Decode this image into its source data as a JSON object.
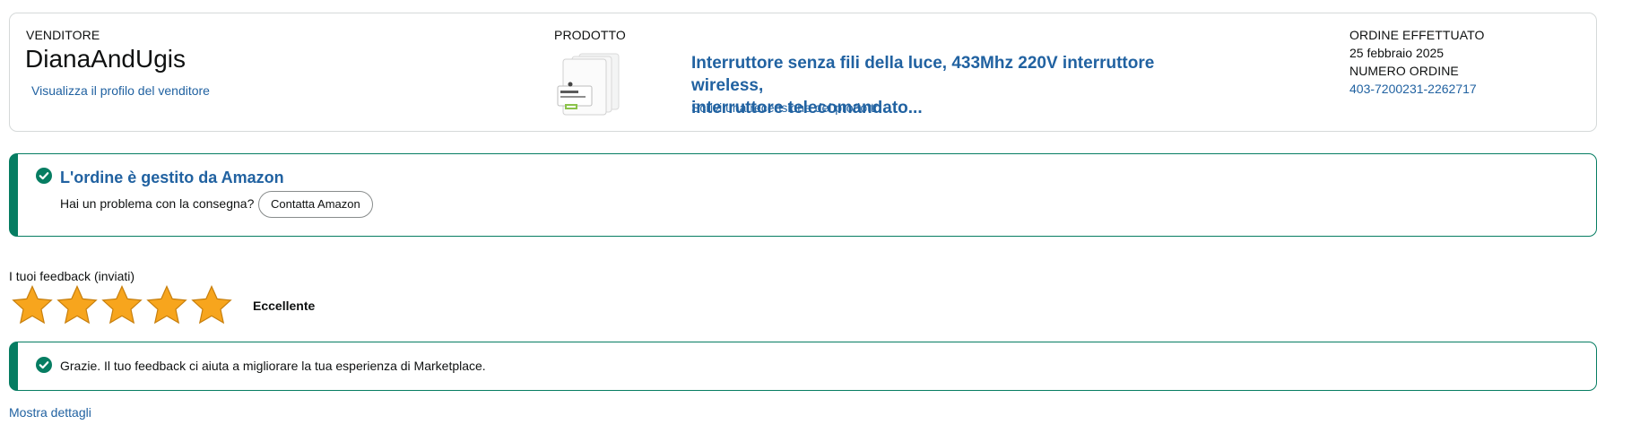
{
  "seller": {
    "caption": "VENDITORE",
    "name": "DianaAndUgis",
    "profile_link": "Visualizza il profilo del venditore"
  },
  "product": {
    "caption": "PRODOTTO",
    "title_line1": "Interruttore senza fili della luce, 433Mhz 220V interruttore wireless,",
    "title_line2": "interruttore telecomandato...",
    "review_link": "Scrivi una recensione del prodotto",
    "image_icon": "product-thumbnail"
  },
  "order": {
    "date_caption": "ORDINE EFFETTUATO",
    "date": "25 febbraio 2025",
    "number_caption": "NUMERO ORDINE",
    "number": "403-7200231-2262717"
  },
  "fulfilment_alert": {
    "icon": "check-circle-icon",
    "title": "L'ordine è gestito da Amazon",
    "question": "Hai un problema con la consegna?",
    "contact_button": "Contatta Amazon"
  },
  "feedback": {
    "heading": "I tuoi feedback (inviati)",
    "rating": 5,
    "max_rating": 5,
    "rating_label": "Eccellente",
    "star_color": "#f7a51d",
    "thanks_icon": "check-circle-icon",
    "thanks_message": "Grazie. Il tuo feedback ci aiuta a migliorare la tua esperienza di Marketplace.",
    "details_link": "Mostra dettagli"
  },
  "colors": {
    "link": "#2162a1",
    "success": "#067d62",
    "border": "#d5d9d9"
  }
}
